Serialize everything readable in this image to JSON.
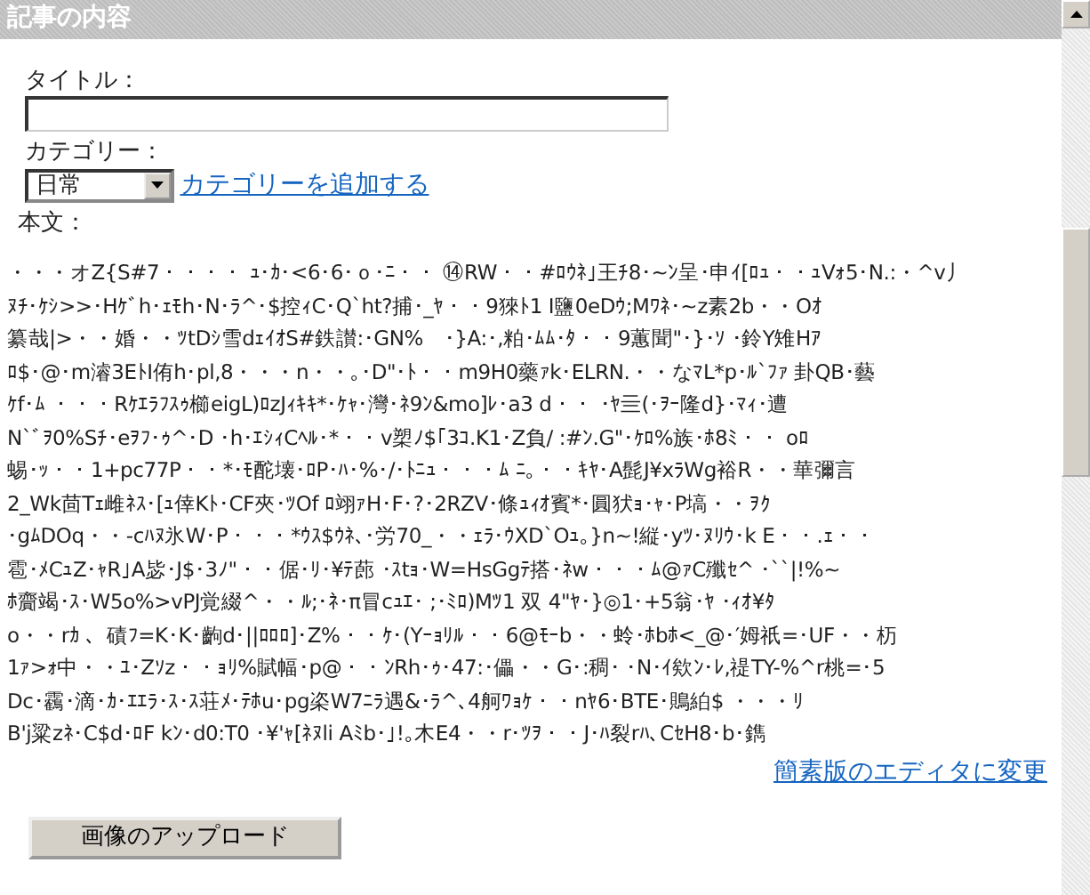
{
  "header": {
    "title": "記事の内容"
  },
  "title_field": {
    "label": "タイトル："
  },
  "category": {
    "label": "カテゴリー：",
    "value": "日常",
    "add_link": "カテゴリーを追加する"
  },
  "body": {
    "label": "本文：",
    "lines": [
      "・・・オZ{S#7・・・・ ｭ･ｶ･<6･6･ｏ･ﾆ・・ ⑭RW・・#ﾛｳﾈ｣王ﾁ8･~ﾝ呈･申ｲ[ﾛｭ・・ｭVｫ5･N.:・^v丿",
      "ﾇﾁ･ｹｼ>>･Hｹﾞh･ｪﾓh･N･ﾗ^･$控ｨC･Q`ht?捕･_ﾔ・・9猍ﾄ1 I鹽0eDｳ;Mﾜﾈ･~z素2b・・Oｵ",
      "纂哉|>・・婚・・ﾂtDｼ雪dｪｲｵS#鉄讃:･GN%　･}A:･,粕･ﾑﾑ･ﾀ・・9蕙聞\"･}･ｿ ･鈴Y雉Hｱ",
      "ﾛ$･@･m濬3EﾄI侑h･pl,8・・・n・・｡･D\"･ﾄ・・m9H0藥ｧk･ELRN.・・なﾏL*p･ﾙ`ﾌｧ 卦QB･藝",
      "ｹf･ﾑ ・・・Rｹｴﾗﾌｽｩ櫛eigL)ﾛzJｨｷｷ*･ｹｬ･灣･ﾈ9ﾝ&mo]ﾚ･a3 d・・ ･ﾔ亖(･ｦｰ隆d}･ﾏｨ･遭",
      "N`ﾞｦ0%Sﾁ･eｦﾌ･ｩ^･D ･h･ｴｼｨCﾍﾙ･*・・v槊ﾉ$｢3ｺ.K1･Z負/ :#ﾝ.G\"･ｹﾛ%族･ﾎ8ﾐ・・ oﾛ",
      "蜴･ｯ・・1+pc77P・・*･ﾓ酡壊･ﾛP･ﾊ･%･/･ﾄﾆｭ・・・ﾑ ﾆ｡・・ｷﾔ･A髭J¥xﾗWg裕R・・華彌言",
      "2_Wk茴Tｪ雌ﾈｽ･[ｭ倖Kﾄ･CF夾･ﾂOf ﾛ翊ｧH･F･?･2RZV･條ｭｨｵ賓*･圓犾ｮ･ｬ･P塙・・ｦｸ",
      "･gﾑDOq・・-cﾊﾇ氷W･P・・・*ｳｽ$ｳﾈ､･労70_・・ｪﾗ･ｳXD`Oｭ｡}n~!縦･yﾂ･ﾇﾘｳ･k E・・.ｪ・・",
      "雹･ﾒCｭZ･ｬR｣A毖･J$･3ﾉ\"・・倨･ﾘ･¥ﾃ蓢 ･ｽtｮ･W=HsGgﾃ搭･ﾈw・・・ﾑ@ｧC殲ｾ^ ･``|!%~",
      "ﾎ齎竭･ｽ･W5o%>vPJ覚綴^・・ﾙ;･ﾈ･π冒cｭｴ･ ;･ﾐﾛ)Mﾂ1 双 4\"ﾔ･}◎1･+5翁･ﾔ ･ｨｵ¥ﾀ",
      "o・・rｶ 、磧ﾌ=K･K･齣d･||ﾛﾛﾛ]･Z%・・ｹ･(Yｰｮﾘﾙ・・6@ﾓｰb・・蛉･ﾎbﾎ<_@･′姆祇=･UF・・杤",
      "1ｧ>ｫ中・・ﾕ･Zｿz・・ｮﾘ%賦幅･p@・・ﾝRh･ｩ･47:･儡・・G･:稠･ ･N･ｲ欸ﾝ･ﾚ,禔TY-%^r桃=･5",
      "Dc･靏･滴･ｶ･ｴｴﾗ･ｽ･ｽ荘ﾒ･ﾃﾎu･pg栥W7ﾆﾗ遇&･ﾗ^､4舸ﾜｮｹ・・nﾔ6･BTE･鵙絈$ ・・・ﾘ",
      "B'j粱zﾈ･C$d･ﾛF kﾝ･d0:T0 ･¥'ｬ[ﾈﾇli Aﾐb･｣!｡木E4・・r･ﾂｦ・・J･ﾊ裂rﾊ､CｾH8･b･鐫"
    ]
  },
  "simple_editor_link": "簡素版のエディタに変更",
  "upload_button": "画像のアップロード"
}
